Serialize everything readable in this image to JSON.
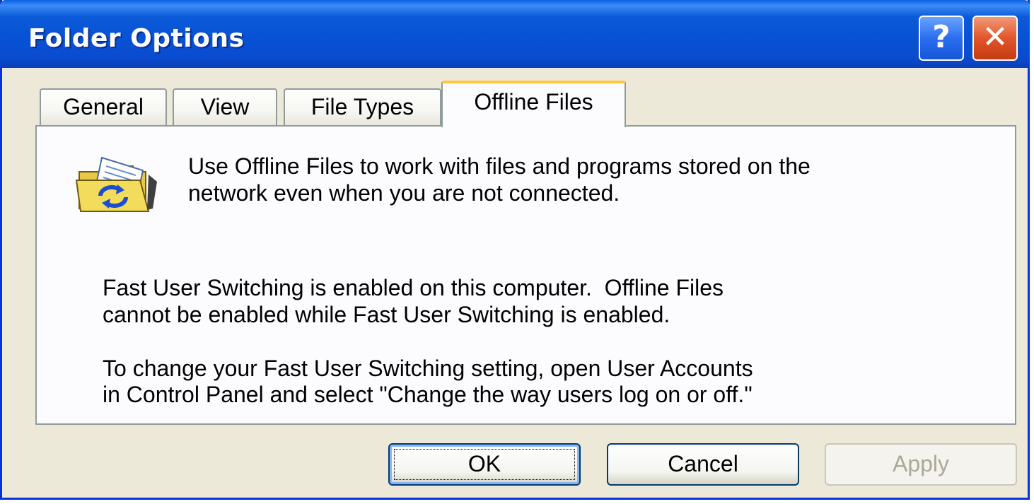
{
  "window": {
    "title": "Folder Options",
    "help_label": "?",
    "close_label": "✕"
  },
  "tabs": [
    {
      "label": "General",
      "active": false
    },
    {
      "label": "View",
      "active": false
    },
    {
      "label": "File Types",
      "active": false
    },
    {
      "label": "Offline Files",
      "active": true
    }
  ],
  "panel": {
    "icon": "offline-files-folder-icon",
    "intro_line1": "Use Offline Files to work with files and programs stored on the",
    "intro_line2": "network even when you are not connected.",
    "fus_line1": "Fast User Switching is enabled on this computer.  Offline Files",
    "fus_line2": "cannot be enabled while Fast User Switching is enabled.",
    "change_line1": "To change your Fast User Switching setting, open User Accounts",
    "change_line2": "in Control Panel and select \"Change the way users log on or off.\""
  },
  "buttons": {
    "ok": "OK",
    "cancel": "Cancel",
    "apply": "Apply"
  },
  "colors": {
    "titlebar": "#0a5ad8",
    "window_bg": "#ece9d8",
    "active_tab_accent": "#ffc73c",
    "close_button": "#e2552a"
  }
}
